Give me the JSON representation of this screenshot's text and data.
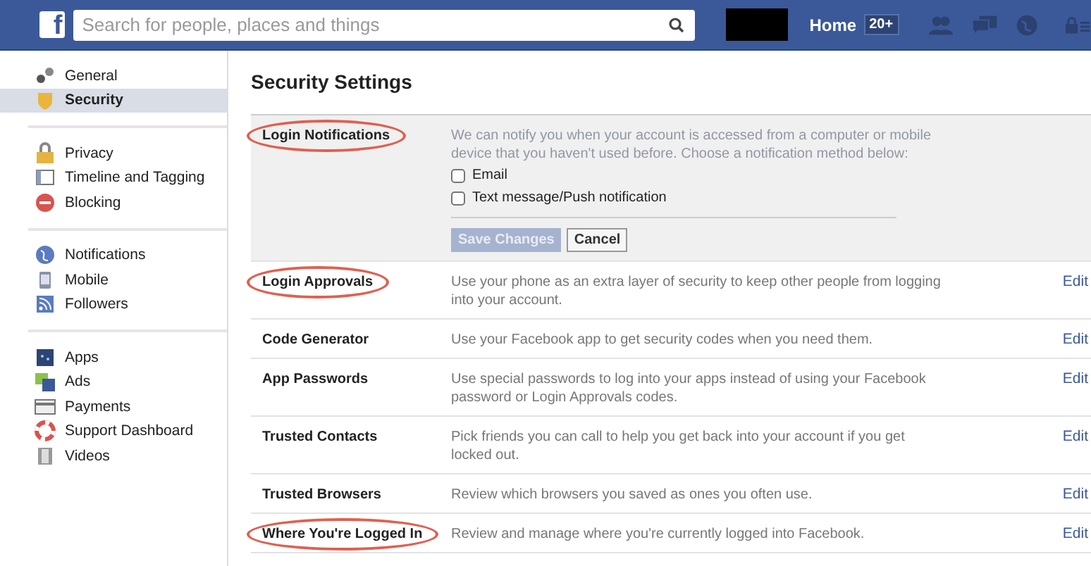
{
  "header": {
    "logo": "f",
    "search": {
      "placeholder": "Search for people, places and things"
    },
    "home": {
      "label": "Home",
      "badge": "20+"
    }
  },
  "sidebar": {
    "groups": [
      [
        {
          "label": "General",
          "selected": false
        },
        {
          "label": "Security",
          "selected": true
        }
      ],
      [
        {
          "label": "Privacy",
          "selected": false
        },
        {
          "label": "Timeline and Tagging",
          "selected": false
        },
        {
          "label": "Blocking",
          "selected": false
        }
      ],
      [
        {
          "label": "Notifications",
          "selected": false
        },
        {
          "label": "Mobile",
          "selected": false
        },
        {
          "label": "Followers",
          "selected": false
        }
      ],
      [
        {
          "label": "Apps",
          "selected": false
        },
        {
          "label": "Ads",
          "selected": false
        },
        {
          "label": "Payments",
          "selected": false
        },
        {
          "label": "Support Dashboard",
          "selected": false
        },
        {
          "label": "Videos",
          "selected": false
        }
      ]
    ]
  },
  "title": "Security Settings",
  "settings": [
    {
      "kind": "expanded",
      "label": "Login Notifications",
      "circled": true,
      "description": "We can notify you when your account is accessed from a computer or mobile device that you haven't used before. Choose a notification method below:",
      "options": [
        {
          "label": "Email",
          "checked": false
        },
        {
          "label": "Text message/Push notification",
          "checked": false
        }
      ],
      "buttons": [
        {
          "label": "Save Changes",
          "kind": "primary",
          "disabled": true
        },
        {
          "label": "Cancel",
          "kind": "secondary",
          "disabled": false
        }
      ]
    },
    {
      "kind": "collapsed",
      "label": "Login Approvals",
      "circled": true,
      "description": "Use your phone as an extra layer of security to keep other people from logging into your account.",
      "action": "Edit"
    },
    {
      "kind": "collapsed",
      "label": "Code Generator",
      "circled": false,
      "description": "Use your Facebook app to get security codes when you need them.",
      "action": "Edit"
    },
    {
      "kind": "collapsed",
      "label": "App Passwords",
      "circled": false,
      "description": "Use special passwords to log into your apps instead of using your Facebook password or Login Approvals codes.",
      "action": "Edit"
    },
    {
      "kind": "collapsed",
      "label": "Trusted Contacts",
      "circled": false,
      "description": "Pick friends you can call to help you get back into your account if you get locked out.",
      "action": "Edit"
    },
    {
      "kind": "collapsed",
      "label": "Trusted Browsers",
      "circled": false,
      "description": "Review which browsers you saved as ones you often use.",
      "action": "Edit"
    },
    {
      "kind": "collapsed",
      "label": "Where You're Logged In",
      "circled": true,
      "description": "Review and manage where you're currently logged into Facebook.",
      "action": "Edit"
    }
  ]
}
